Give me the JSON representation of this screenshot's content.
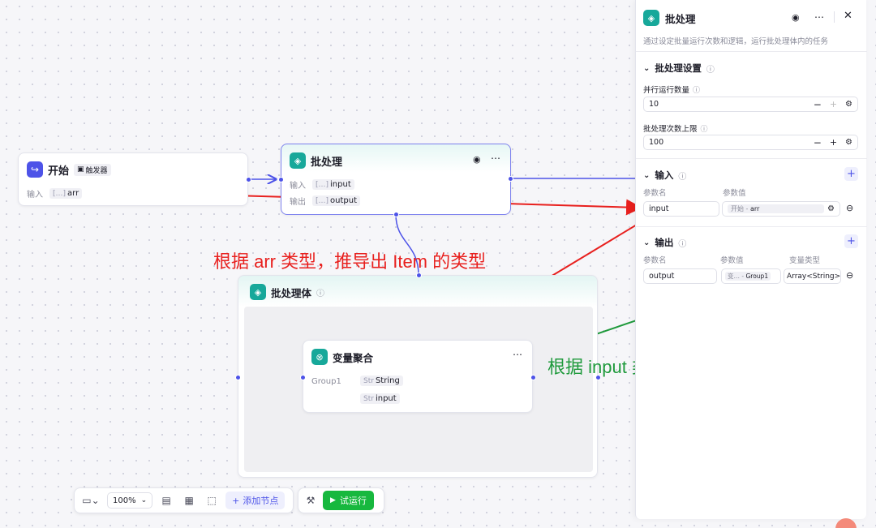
{
  "start_node": {
    "title": "开始",
    "trigger_label": "触发器",
    "input_label": "输入",
    "input_var": "arr",
    "input_var_type": "[…]"
  },
  "batch_node": {
    "title": "批处理",
    "input_label": "输入",
    "input_var": "input",
    "output_label": "输出",
    "output_var": "output",
    "var_type": "[…]"
  },
  "batch_body": {
    "title": "批处理体"
  },
  "var_agg_node": {
    "title": "变量聚合",
    "group_label": "Group1",
    "vars": [
      {
        "type": "Str",
        "name": "String"
      },
      {
        "type": "Str",
        "name": "input"
      }
    ]
  },
  "annotations": {
    "top": "根据 arr 类型，推导出 Item 的类型",
    "right": "根据 input 类型推导出 output 类型"
  },
  "panel": {
    "title": "批处理",
    "description": "通过设定批量运行次数和逻辑，运行批处理体内的任务",
    "settings_section": "批处理设置",
    "concurrency_label": "并行运行数量",
    "concurrency_value": "10",
    "limit_label": "批处理次数上限",
    "limit_value": "100",
    "input_section": "输入",
    "input_col_name": "参数名",
    "input_col_value": "参数值",
    "input_param_name": "input",
    "input_param_ref_node": "开始",
    "input_param_ref_var": "arr",
    "output_section": "输出",
    "output_col_name": "参数名",
    "output_col_value": "参数值",
    "output_col_type": "变量类型",
    "output_param_name": "output",
    "output_param_ref_node": "变…",
    "output_param_ref_var": "Group1",
    "output_param_type": "Array<String>"
  },
  "toolbar": {
    "zoom": "100%",
    "add_node": "添加节点",
    "test_run": "试运行"
  },
  "colors": {
    "accent": "#4d53e8",
    "batch_icon": "#17a89a",
    "red_annot": "#e8201e",
    "green_annot": "#1f9a3c",
    "run_btn": "#17b83e"
  }
}
